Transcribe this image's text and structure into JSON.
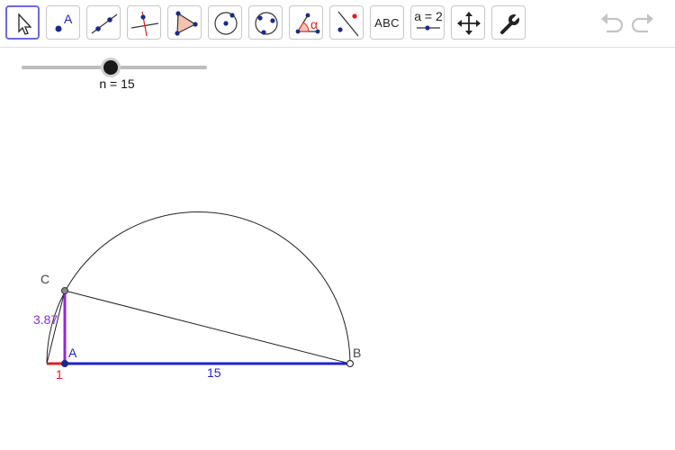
{
  "toolbar": {
    "tools": [
      {
        "name": "move-tool-icon"
      },
      {
        "name": "point-tool-icon",
        "glyph": "A"
      },
      {
        "name": "line-tool-icon"
      },
      {
        "name": "perpendicular-line-tool-icon"
      },
      {
        "name": "polygon-tool-icon"
      },
      {
        "name": "circle-center-point-tool-icon"
      },
      {
        "name": "circle-three-points-tool-icon"
      },
      {
        "name": "angle-tool-icon",
        "glyph": "α"
      },
      {
        "name": "reflect-tool-icon"
      },
      {
        "name": "text-tool-icon",
        "label": "ABC"
      },
      {
        "name": "slider-tool-icon",
        "label": "a = 2"
      },
      {
        "name": "move-graphics-view-tool-icon"
      },
      {
        "name": "settings-tool-icon"
      }
    ],
    "undo_icon": "undo-icon",
    "redo_icon": "redo-icon"
  },
  "slider": {
    "caption": "n = 15",
    "value": 15
  },
  "construction": {
    "points": {
      "A": "A",
      "B": "B",
      "C": "C"
    },
    "labels": {
      "short_segment": "1",
      "long_segment": "15",
      "height": "3.87"
    }
  },
  "colors": {
    "red_segment": "#e02020",
    "blue_segment": "#1f1fd6",
    "purple_segment": "#8a2be2",
    "point_fill": "#1a2a8a",
    "active_tool_border": "#6a6ae0"
  }
}
